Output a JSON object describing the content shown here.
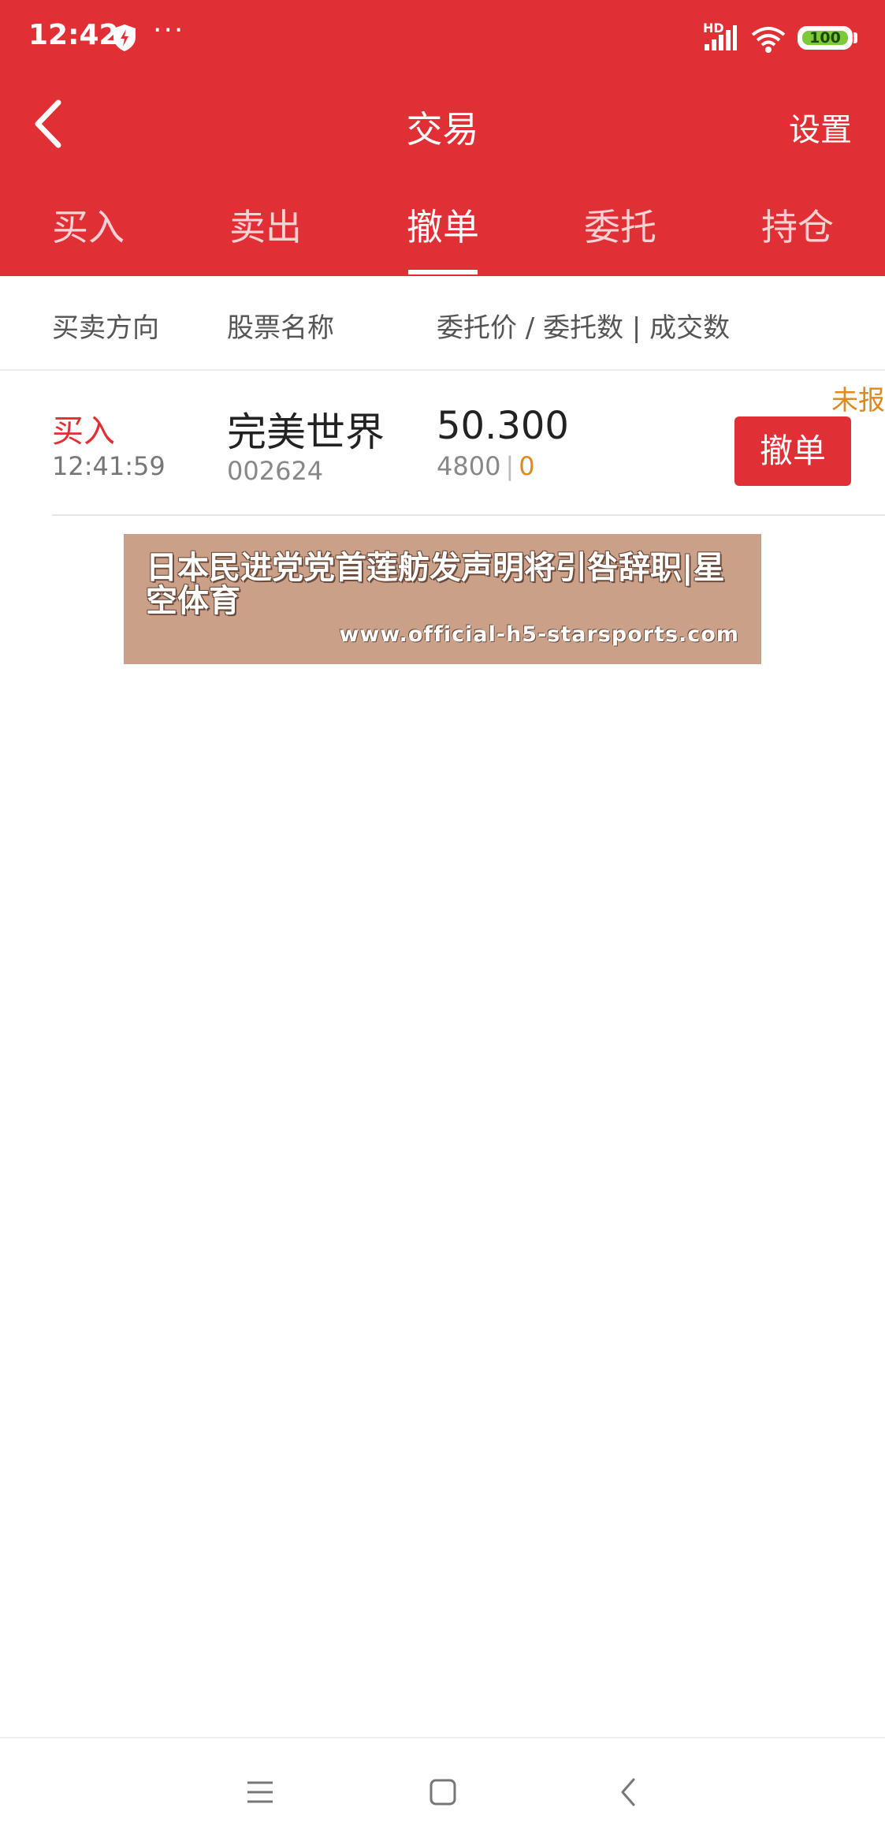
{
  "status_bar": {
    "time": "12:42",
    "dots": "···",
    "network_label": "HD",
    "battery": "100",
    "icons": [
      "shield-icon",
      "signal-icon",
      "wifi-icon",
      "battery-icon"
    ]
  },
  "nav": {
    "title": "交易",
    "settings_label": "设置",
    "back_icon": "chevron-left-icon"
  },
  "tabs": [
    {
      "label": "买入",
      "active": false
    },
    {
      "label": "卖出",
      "active": false
    },
    {
      "label": "撤单",
      "active": true
    },
    {
      "label": "委托",
      "active": false
    },
    {
      "label": "持仓",
      "active": false
    }
  ],
  "columns": {
    "direction": "买卖方向",
    "stock_name": "股票名称",
    "price_qty": "委托价 / 委托数 | 成交数"
  },
  "orders": [
    {
      "direction": "买入",
      "time": "12:41:59",
      "name": "完美世界",
      "code": "002624",
      "price": "50.300",
      "quantity": "4800",
      "separator": "|",
      "filled": "0",
      "status": "未报",
      "action_label": "撤单"
    }
  ],
  "ad": {
    "headline": "日本民进党党首莲舫发声明将引咎辞职|星空体育",
    "url": "www.official-h5-starsports.com"
  },
  "colors": {
    "brand_red": "#e03036",
    "status_orange": "#e08a1e"
  },
  "bottom_nav": {
    "icons": [
      "menu-icon",
      "home-square-icon",
      "back-triangle-icon"
    ]
  }
}
